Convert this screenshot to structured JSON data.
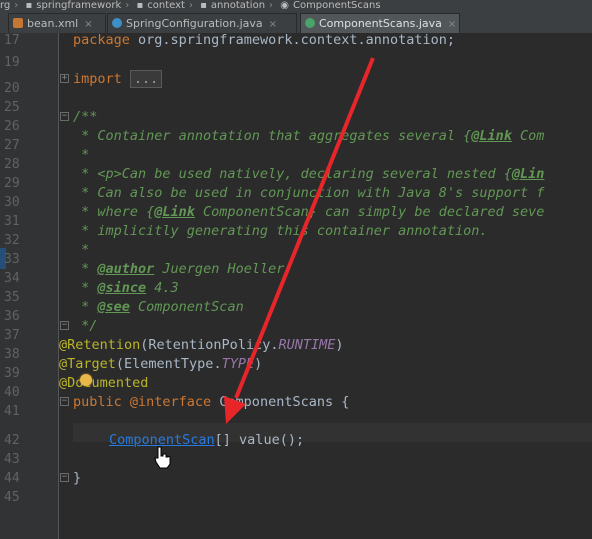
{
  "breadcrumb": [
    "rg",
    "springframework",
    "context",
    "annotation",
    "ComponentScans"
  ],
  "tabs": [
    {
      "label": "bean.xml",
      "active": false,
      "icon": "xml-file-icon"
    },
    {
      "label": "SpringConfiguration.java",
      "active": false,
      "icon": "java-class-icon"
    },
    {
      "label": "ComponentScans.java",
      "active": true,
      "icon": "annotation-file-icon"
    }
  ],
  "line_numbers": [
    "17",
    "19",
    "20",
    "25",
    "26",
    "27",
    "28",
    "29",
    "30",
    "31",
    "32",
    "33",
    "34",
    "35",
    "36",
    "37",
    "38",
    "39",
    "40",
    "41",
    "42",
    "43",
    "44",
    "45"
  ],
  "code": {
    "package_kw": "package",
    "package_name": " org.springframework.context.annotation;",
    "import_kw": "import",
    "import_collapsed": "...",
    "doc_open": "/**",
    "doc_l1_a": " * Container annotation that aggregates several ",
    "doc_l1_link": "@Link",
    "doc_l1_b": " Com",
    "doc_blank": " *",
    "doc_l3_a": " * <p>Can be used natively, declaring several nested {",
    "doc_l3_link": "@Lin",
    "doc_l4": " * Can also be used in conjunction with Java 8's support f",
    "doc_l5_a": " * where {",
    "doc_l5_link": "@Link",
    "doc_l5_b": " ComponentScan} can simply be declared seve",
    "doc_l6": " * implicitly generating this container annotation.",
    "doc_author_tag": "@author",
    "doc_author_val": " Juergen Hoeller",
    "doc_since_tag": "@since",
    "doc_since_val": " 4.3",
    "doc_see_tag": "@see",
    "doc_see_val": " ComponentScan",
    "doc_close": " */",
    "retention_ann": "@Retention",
    "retention_a": "(RetentionPolicy.",
    "retention_const": "RUNTIME",
    "retention_b": ")",
    "target_ann": "@Target",
    "target_a": "(ElementType.",
    "target_const": "TYPE",
    "target_b": ")",
    "documented_ann": "@Documented",
    "decl_kw": "public @interface",
    "decl_name": " ComponentScans {",
    "member_type": "ComponentScan",
    "member_rest": "[] value();",
    "closing": "}"
  },
  "colors": {
    "background": "#2b2b2b",
    "keyword": "#cc7832",
    "annotation": "#bbb529",
    "javadoc": "#629755",
    "constant": "#9876aa",
    "link": "#287bde",
    "arrow": "#e8262a"
  }
}
